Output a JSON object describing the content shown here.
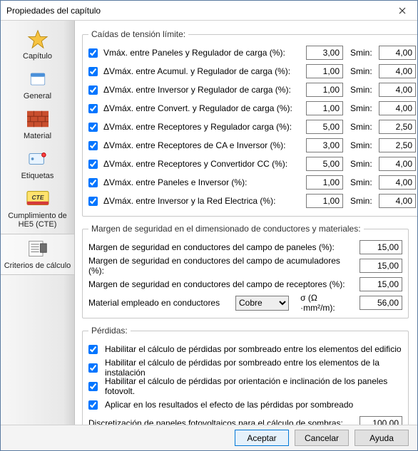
{
  "window": {
    "title": "Propiedades del capítulo"
  },
  "sidebar": {
    "items": [
      {
        "label": "Capítulo"
      },
      {
        "label": "General"
      },
      {
        "label": "Material"
      },
      {
        "label": "Etiquetas"
      },
      {
        "label": "Cumplimiento de HE5 (CTE)"
      },
      {
        "label": "Criterios de cálculo"
      }
    ]
  },
  "group_caidas": {
    "legend": "Caídas de tensión límite:",
    "smin_label": "Smin:",
    "rows": [
      {
        "label": "Vmáx. entre Paneles y Regulador de carga (%):",
        "value": "3,00",
        "smin": "4,00"
      },
      {
        "label": "ΔVmáx. entre Acumul. y Regulador de carga (%):",
        "value": "1,00",
        "smin": "4,00"
      },
      {
        "label": "ΔVmáx. entre Inversor y Regulador de carga (%):",
        "value": "1,00",
        "smin": "4,00"
      },
      {
        "label": "ΔVmáx. entre Convert. y Regulador de carga (%):",
        "value": "1,00",
        "smin": "4,00"
      },
      {
        "label": "ΔVmáx. entre Receptores y Regulador carga (%):",
        "value": "5,00",
        "smin": "2,50"
      },
      {
        "label": "ΔVmáx. entre Receptores de CA e Inversor (%):",
        "value": "3,00",
        "smin": "2,50"
      },
      {
        "label": "ΔVmáx. entre Receptores y Convertidor CC (%):",
        "value": "5,00",
        "smin": "4,00"
      },
      {
        "label": "ΔVmáx. entre Paneles e Inversor  (%):",
        "value": "1,00",
        "smin": "4,00"
      },
      {
        "label": "ΔVmáx. entre Inversor y la Red Electrica (%):",
        "value": "1,00",
        "smin": "4,00"
      }
    ]
  },
  "group_margen": {
    "legend": "Margen de seguridad en el dimensionado de conductores y materiales:",
    "rows": [
      {
        "label": "Margen de seguridad en conductores del campo de paneles (%):",
        "value": "15,00"
      },
      {
        "label": "Margen de seguridad en conductores del campo de acumuladores (%):",
        "value": "15,00"
      },
      {
        "label": "Margen de seguridad en conductores del campo de receptores (%):",
        "value": "15,00"
      }
    ],
    "material_label": "Material empleado en conductores",
    "material_value": "Cobre",
    "sigma_label": "σ (Ω ·mm²/m):",
    "sigma_value": "56,00"
  },
  "group_perdidas": {
    "legend": "Pérdidas:",
    "checks": [
      "Habilitar el cálculo de pérdidas por sombreado entre los elementos del edificio",
      "Habilitar el cálculo de pérdidas por sombreado entre los elementos de la instalación",
      "Habilitar el cálculo de pérdidas por orientación e inclinación de los paneles fotovolt.",
      "Aplicar en los resultados el efecto de las pérdidas por sombreado"
    ],
    "disc_label": "Discretización de paneles fotovoltaicos para el cálculo de sombras:",
    "disc_value": "100,00"
  },
  "buttons": {
    "ok": "Aceptar",
    "cancel": "Cancelar",
    "help": "Ayuda"
  }
}
